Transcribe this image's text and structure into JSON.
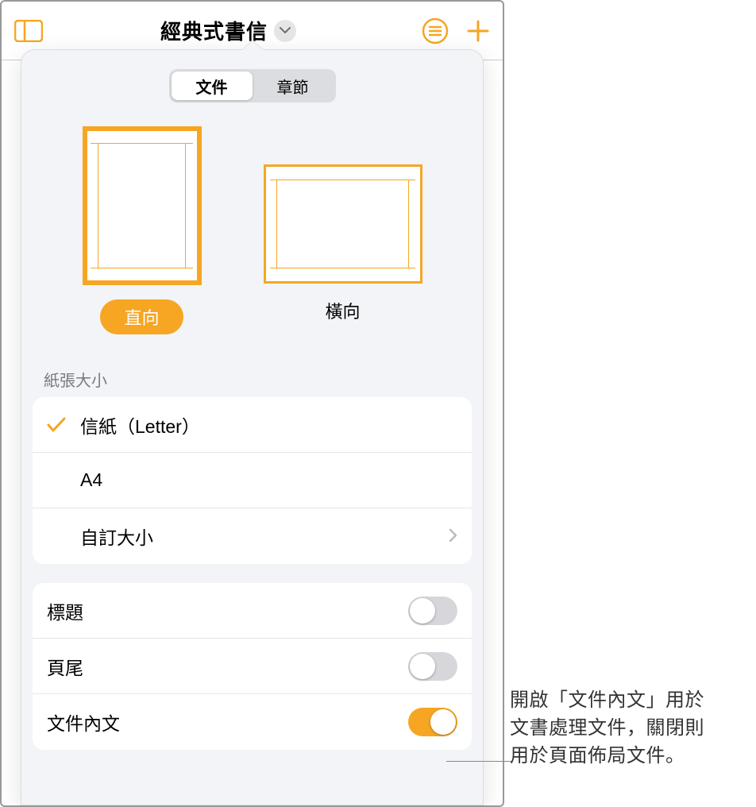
{
  "toolbar": {
    "title": "經典式書信"
  },
  "tabs": {
    "document": "文件",
    "section": "章節"
  },
  "orientation": {
    "portrait": "直向",
    "landscape": "橫向"
  },
  "paper": {
    "section_label": "紙張大小",
    "letter": "信紙（Letter）",
    "a4": "A4",
    "custom": "自訂大小"
  },
  "switches": {
    "header": "標題",
    "footer": "頁尾",
    "body": "文件內文"
  },
  "callout": {
    "line1": "開啟「文件內文」用於",
    "line2": "文書處理文件，關閉則",
    "line3": "用於頁面佈局文件。"
  }
}
